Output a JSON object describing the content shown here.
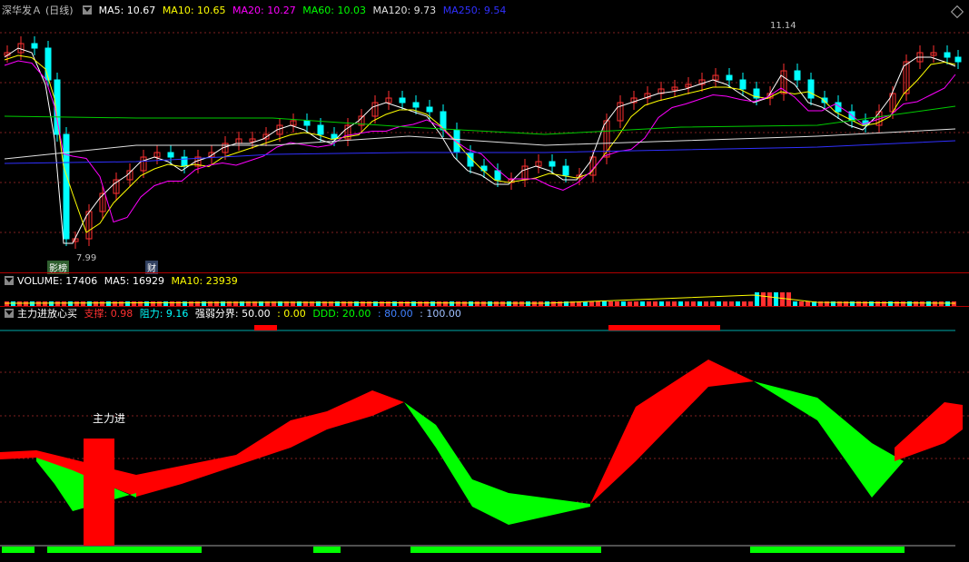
{
  "kline": {
    "stock_name": "深华发Ａ",
    "period": "(日线)",
    "ma": [
      {
        "label": "MA5: 10.67",
        "color": "#ffffff"
      },
      {
        "label": "MA10: 10.65",
        "color": "#ffff00"
      },
      {
        "label": "MA20: 10.27",
        "color": "#ff00ff"
      },
      {
        "label": "MA60: 10.03",
        "color": "#00ff00"
      },
      {
        "label": "MA120: 9.73",
        "color": "#e0e0e0"
      },
      {
        "label": "MA250: 9.54",
        "color": "#3030ff"
      }
    ],
    "high_label": "11.14",
    "low_label": "7.99",
    "tag1": "影榜",
    "tag2": "财"
  },
  "volume": {
    "label": "VOLUME: 17406",
    "ma5": "MA5: 16929",
    "ma10": "MA10: 23939"
  },
  "indicator": {
    "name": "主力进放心买",
    "support_label": "支撑",
    "support_value": ": 0.98",
    "resist_label": "阻力",
    "resist_value": ": 9.16",
    "divide_label": "强弱分界",
    "divide_value": ": 50.00",
    "v0": ": 0.00",
    "ddd_label": "DDD: 20.00",
    "v80": ": 80.00",
    "v100": ": 100.00",
    "annotation": "主力进"
  },
  "colors": {
    "up": "#ff3030",
    "down": "#00ffff",
    "red": "#ff0000",
    "green": "#00ff00"
  }
}
